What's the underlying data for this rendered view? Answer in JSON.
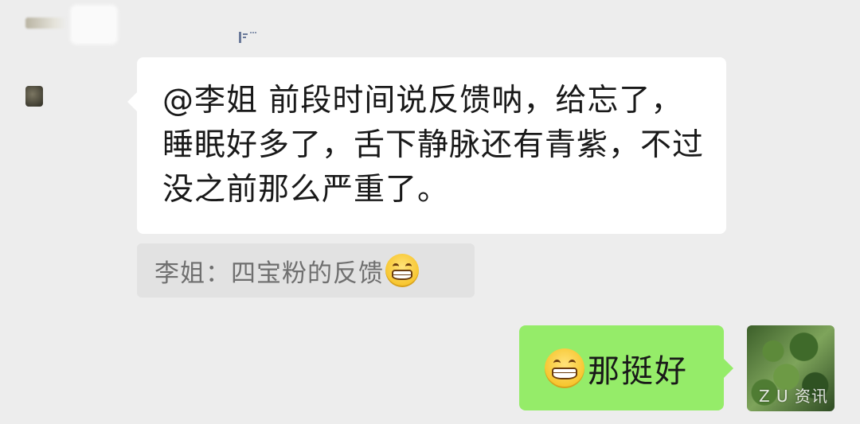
{
  "messages": {
    "incoming": {
      "text": "@李姐  前段时间说反馈呐，给忘了，睡眠好多了，舌下静脉还有青紫，不过没之前那么严重了。"
    },
    "quote": {
      "text": "李姐：四宝粉的反馈",
      "emoji": "grinning-face-emoji"
    },
    "outgoing": {
      "emoji": "grinning-face-emoji",
      "text": "那挺好"
    }
  },
  "avatar": {
    "watermark": "Z U 资讯"
  },
  "colors": {
    "background": "#ededed",
    "incoming_bubble": "#ffffff",
    "outgoing_bubble": "#95ec69",
    "quote_bubble": "#e2e2e2",
    "text": "#191919",
    "quote_text": "#6f6f6f"
  }
}
